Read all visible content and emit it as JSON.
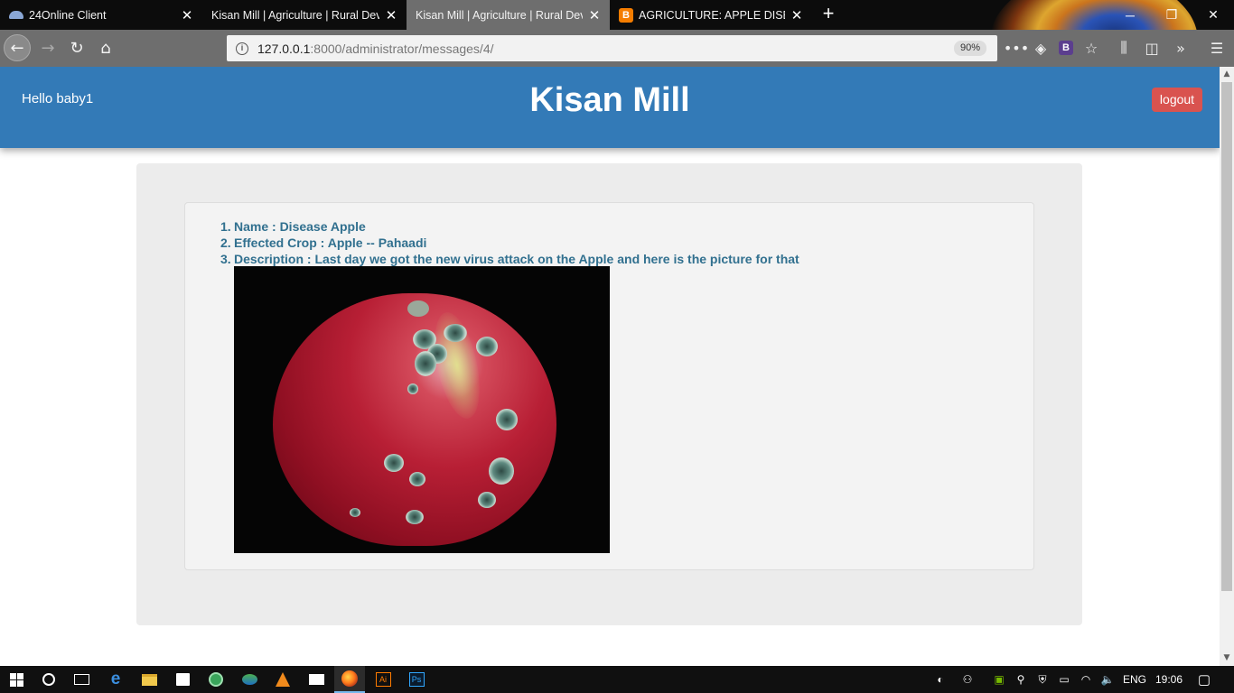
{
  "browser": {
    "tabs": [
      {
        "title": "24Online Client",
        "icon": "cloud-icon",
        "active": false
      },
      {
        "title": "Kisan Mill | Agriculture | Rural Deve",
        "icon": "",
        "active": false
      },
      {
        "title": "Kisan Mill | Agriculture | Rural Deve",
        "icon": "",
        "active": true
      },
      {
        "title": "AGRICULTURE: APPLE DISEASE",
        "icon": "blogger-icon",
        "active": false
      }
    ],
    "blogger_glyph": "B",
    "new_tab_glyph": "+",
    "url_host": "127.0.0.1",
    "url_rest": ":8000/administrator/messages/4/",
    "zoom": "90%",
    "bookmark_ext_glyph": "B"
  },
  "page": {
    "greeting": "Hello baby1",
    "site_title": "Kisan Mill",
    "logout_label": "logout",
    "message": {
      "items": [
        {
          "num": "1.",
          "text": "Name : Disease Apple"
        },
        {
          "num": "2.",
          "text": "Effected Crop : Apple -- Pahaadi"
        },
        {
          "num": "3.",
          "text": "Description : Last day we got the new virus attack on the Apple and here is the picture for that"
        }
      ],
      "photo_subject": "apple with scab disease spots"
    }
  },
  "taskbar": {
    "ai_label": "Ai",
    "ps_label": "Ps",
    "language": "ENG",
    "clock": "19:06"
  },
  "colors": {
    "header_bg": "#337ab7",
    "logout_bg": "#d9534f",
    "message_text": "#31708f"
  }
}
